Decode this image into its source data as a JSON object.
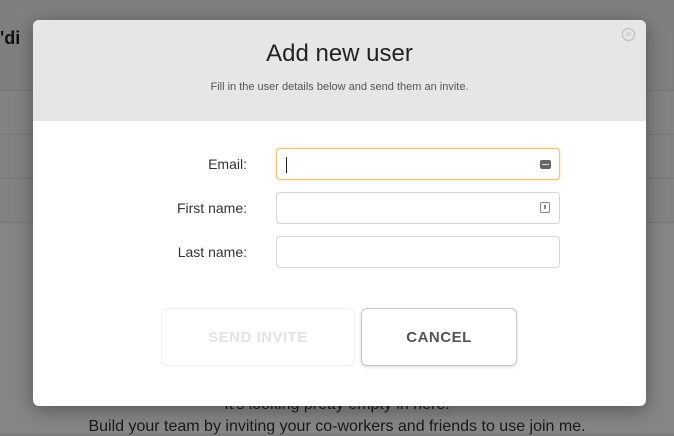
{
  "background": {
    "page_title_fragment": "'di",
    "empty_line_1": "It's looking pretty empty in here.",
    "empty_line_2": "Build your team by inviting your co-workers and friends to use join me."
  },
  "modal": {
    "title": "Add new user",
    "subtitle": "Fill in the user details below and send them an invite.",
    "close_icon": "close-circle-icon",
    "fields": [
      {
        "label": "Email:",
        "value": "",
        "placeholder": "",
        "icon": "contact-card-icon"
      },
      {
        "label": "First name:",
        "value": "",
        "placeholder": "",
        "icon": "password-key-icon"
      },
      {
        "label": "Last name:",
        "value": "",
        "placeholder": ""
      }
    ],
    "buttons": {
      "send": "SEND INVITE",
      "cancel": "CANCEL"
    }
  },
  "colors": {
    "focus_border": "#f0c36d",
    "header_bg": "#e6e6e6",
    "overlay": "rgba(0,0,0,0.48)"
  }
}
